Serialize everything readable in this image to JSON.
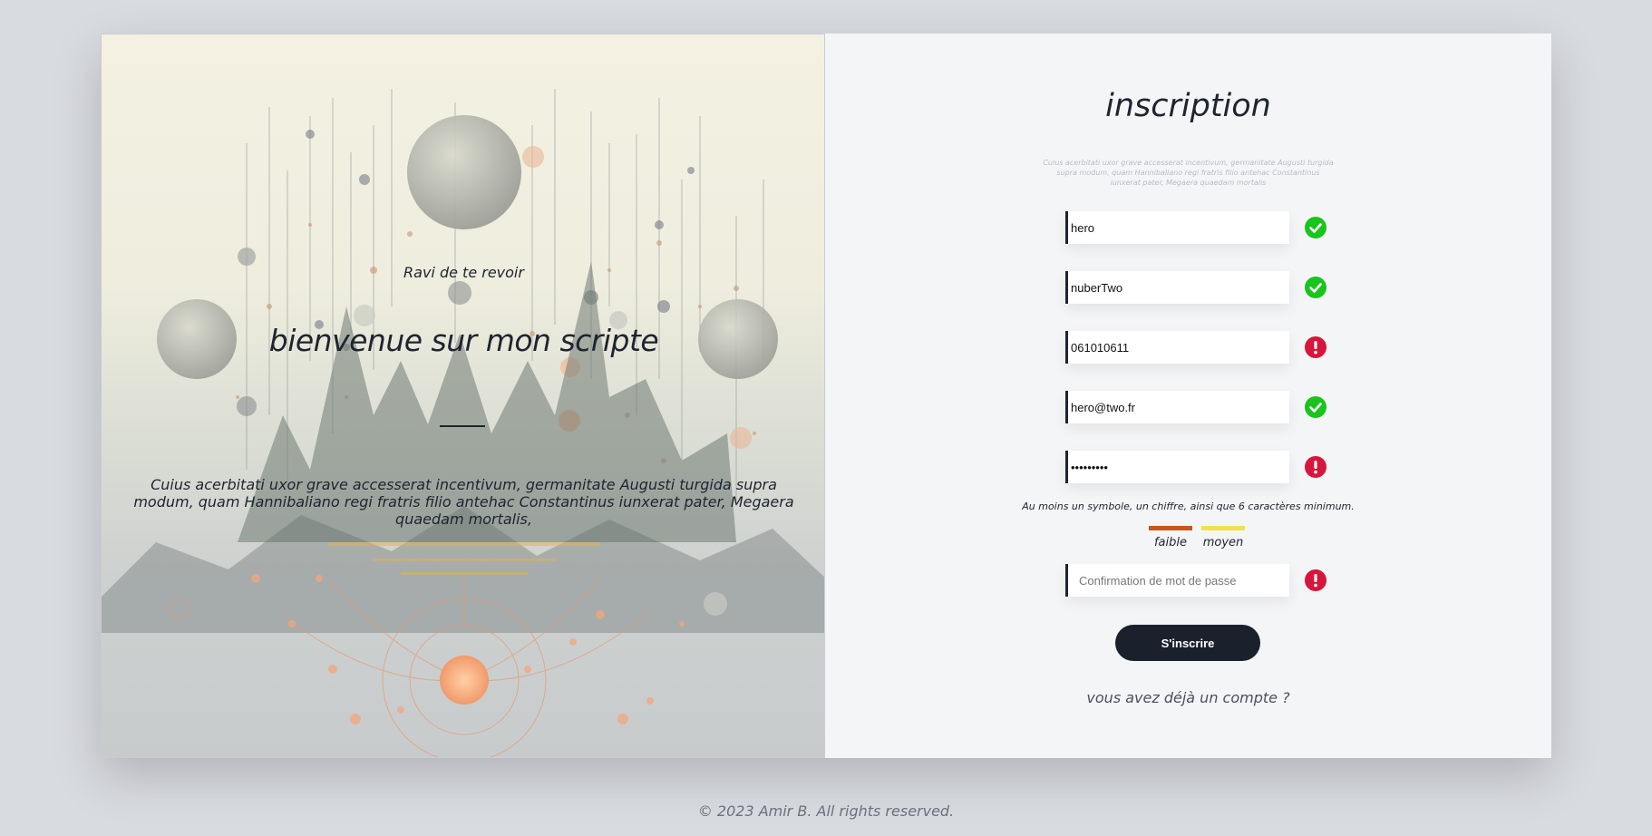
{
  "left": {
    "greeting": "Ravi de te revoir",
    "headline": "bienvenue sur mon scripte",
    "paragraph": "Cuius acerbitati uxor grave accesserat incentivum, germanitate Augusti turgida supra modum, quam Hannibaliano regi fratris filio antehac Constantinus iunxerat pater, Megaera quaedam mortalis,"
  },
  "form": {
    "title": "inscription",
    "description": "Cuius acerbitati uxor grave accesserat incentivum, germanitate Augusti turgida supra modum, quam Hannibaliano regi fratris filio antehac Constantinus iunxerat pater, Megaera quaedam mortalis",
    "fields": {
      "username": {
        "value": "hero",
        "status": "valid"
      },
      "lastname": {
        "value": "nuberTwo",
        "status": "valid"
      },
      "phone": {
        "value": "061010611",
        "status": "invalid"
      },
      "email": {
        "value": "hero@two.fr",
        "status": "valid"
      },
      "password": {
        "value": "•••••••••",
        "status": "invalid"
      },
      "confirm": {
        "value": "",
        "placeholder": "Confirmation de mot de passe",
        "status": "invalid"
      }
    },
    "password_hint": "Au moins un symbole, un chiffre, ainsi que 6 caractères minimum.",
    "strength": {
      "weak_label": "faible",
      "medium_label": "moyen",
      "weak_color": "#c8561c",
      "medium_color": "#f2e04a"
    },
    "submit_label": "S'inscrire",
    "login_link": "vous avez déjà un compte ?"
  },
  "colors": {
    "valid": "#19c41d",
    "invalid": "#d6163a",
    "dark": "#1a202c"
  },
  "footer": "© 2023 Amir B. All rights reserved."
}
